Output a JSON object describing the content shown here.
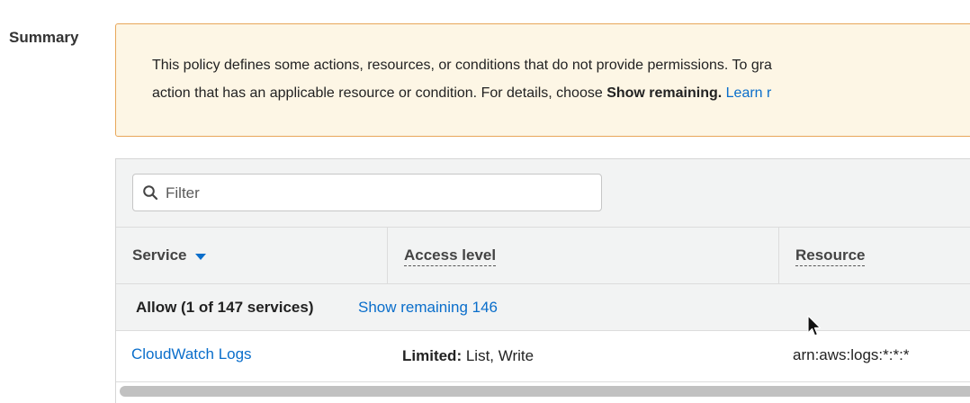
{
  "summary": {
    "label": "Summary"
  },
  "warning": {
    "line1": "This policy defines some actions, resources, or conditions that do not provide permissions. To gra",
    "line2_prefix": "action that has an applicable resource or condition. For details, choose ",
    "line2_bold": "Show remaining.",
    "line2_link": "Learn r"
  },
  "filter": {
    "placeholder": "Filter",
    "value": ""
  },
  "table": {
    "columns": {
      "service": "Service",
      "access_level": "Access level",
      "resource": "Resource"
    },
    "group": {
      "label": "Allow (1 of 147 services)",
      "show_remaining": "Show remaining 146"
    },
    "rows": [
      {
        "service": "CloudWatch Logs",
        "access_bold": "Limited:",
        "access_rest": " List, Write",
        "resource": "arn:aws:logs:*:*:*"
      }
    ]
  },
  "colors": {
    "link": "#0a6ecb",
    "warning_bg": "#fdf6e5",
    "warning_border": "#e8a75a",
    "header_bg": "#f2f3f3"
  }
}
